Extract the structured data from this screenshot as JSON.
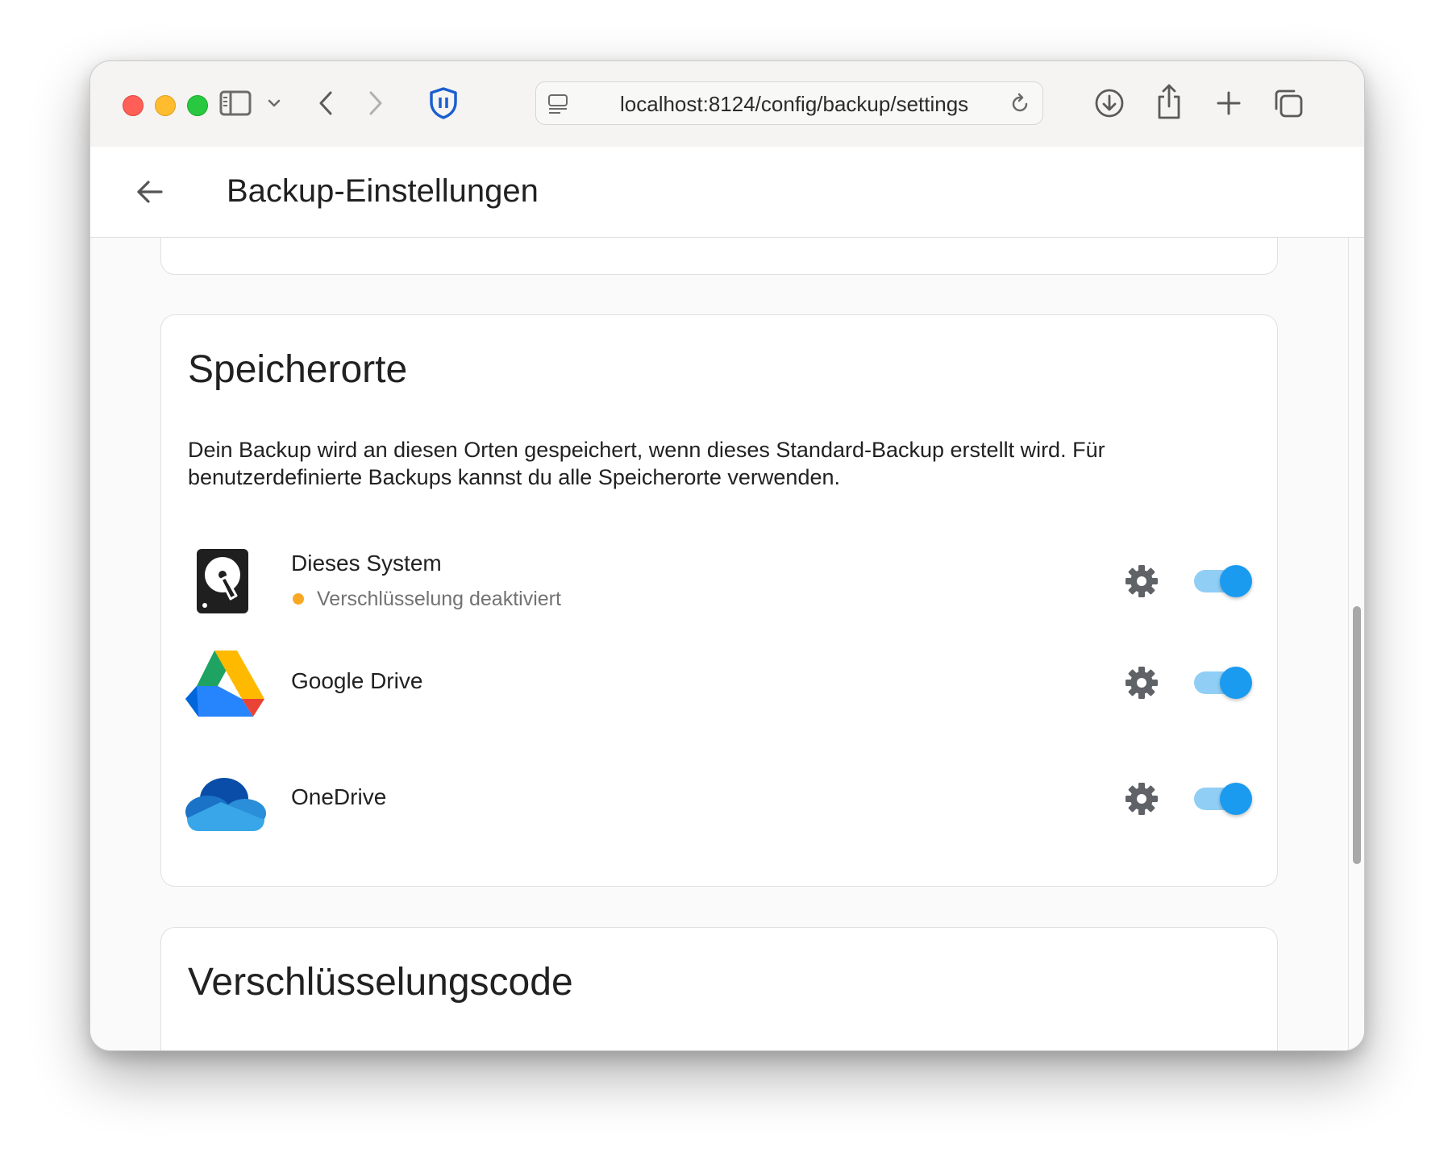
{
  "browser": {
    "url": "localhost:8124/config/backup/settings",
    "icons": [
      "sidebar-icon",
      "chevron-down-icon",
      "back-icon",
      "forward-icon",
      "shield-icon",
      "page-icon",
      "reload-icon",
      "download-icon",
      "share-icon",
      "new-tab-icon",
      "tabs-overview-icon"
    ]
  },
  "header": {
    "title": "Backup-Einstellungen",
    "back_icon": "arrow-left-icon"
  },
  "storage": {
    "title": "Speicherorte",
    "description": "Dein Backup wird an diesen Orten gespeichert, wenn dieses Standard-Backup erstellt wird. Für benutzerdefinierte Backups kannst du alle Speicherorte verwenden.",
    "locations": [
      {
        "name": "Dieses System",
        "status": "Verschlüsselung deaktiviert",
        "status_color": "#f9a825",
        "icon": "hard-drive-icon",
        "enabled": true
      },
      {
        "name": "Google Drive",
        "icon": "google-drive-icon",
        "enabled": true
      },
      {
        "name": "OneDrive",
        "icon": "onedrive-icon",
        "enabled": true
      }
    ]
  },
  "encryption": {
    "title": "Verschlüsselungscode"
  },
  "colors": {
    "accent": "#1a9bf0",
    "toggle_track": "#90cef5",
    "warning": "#f9a825"
  }
}
